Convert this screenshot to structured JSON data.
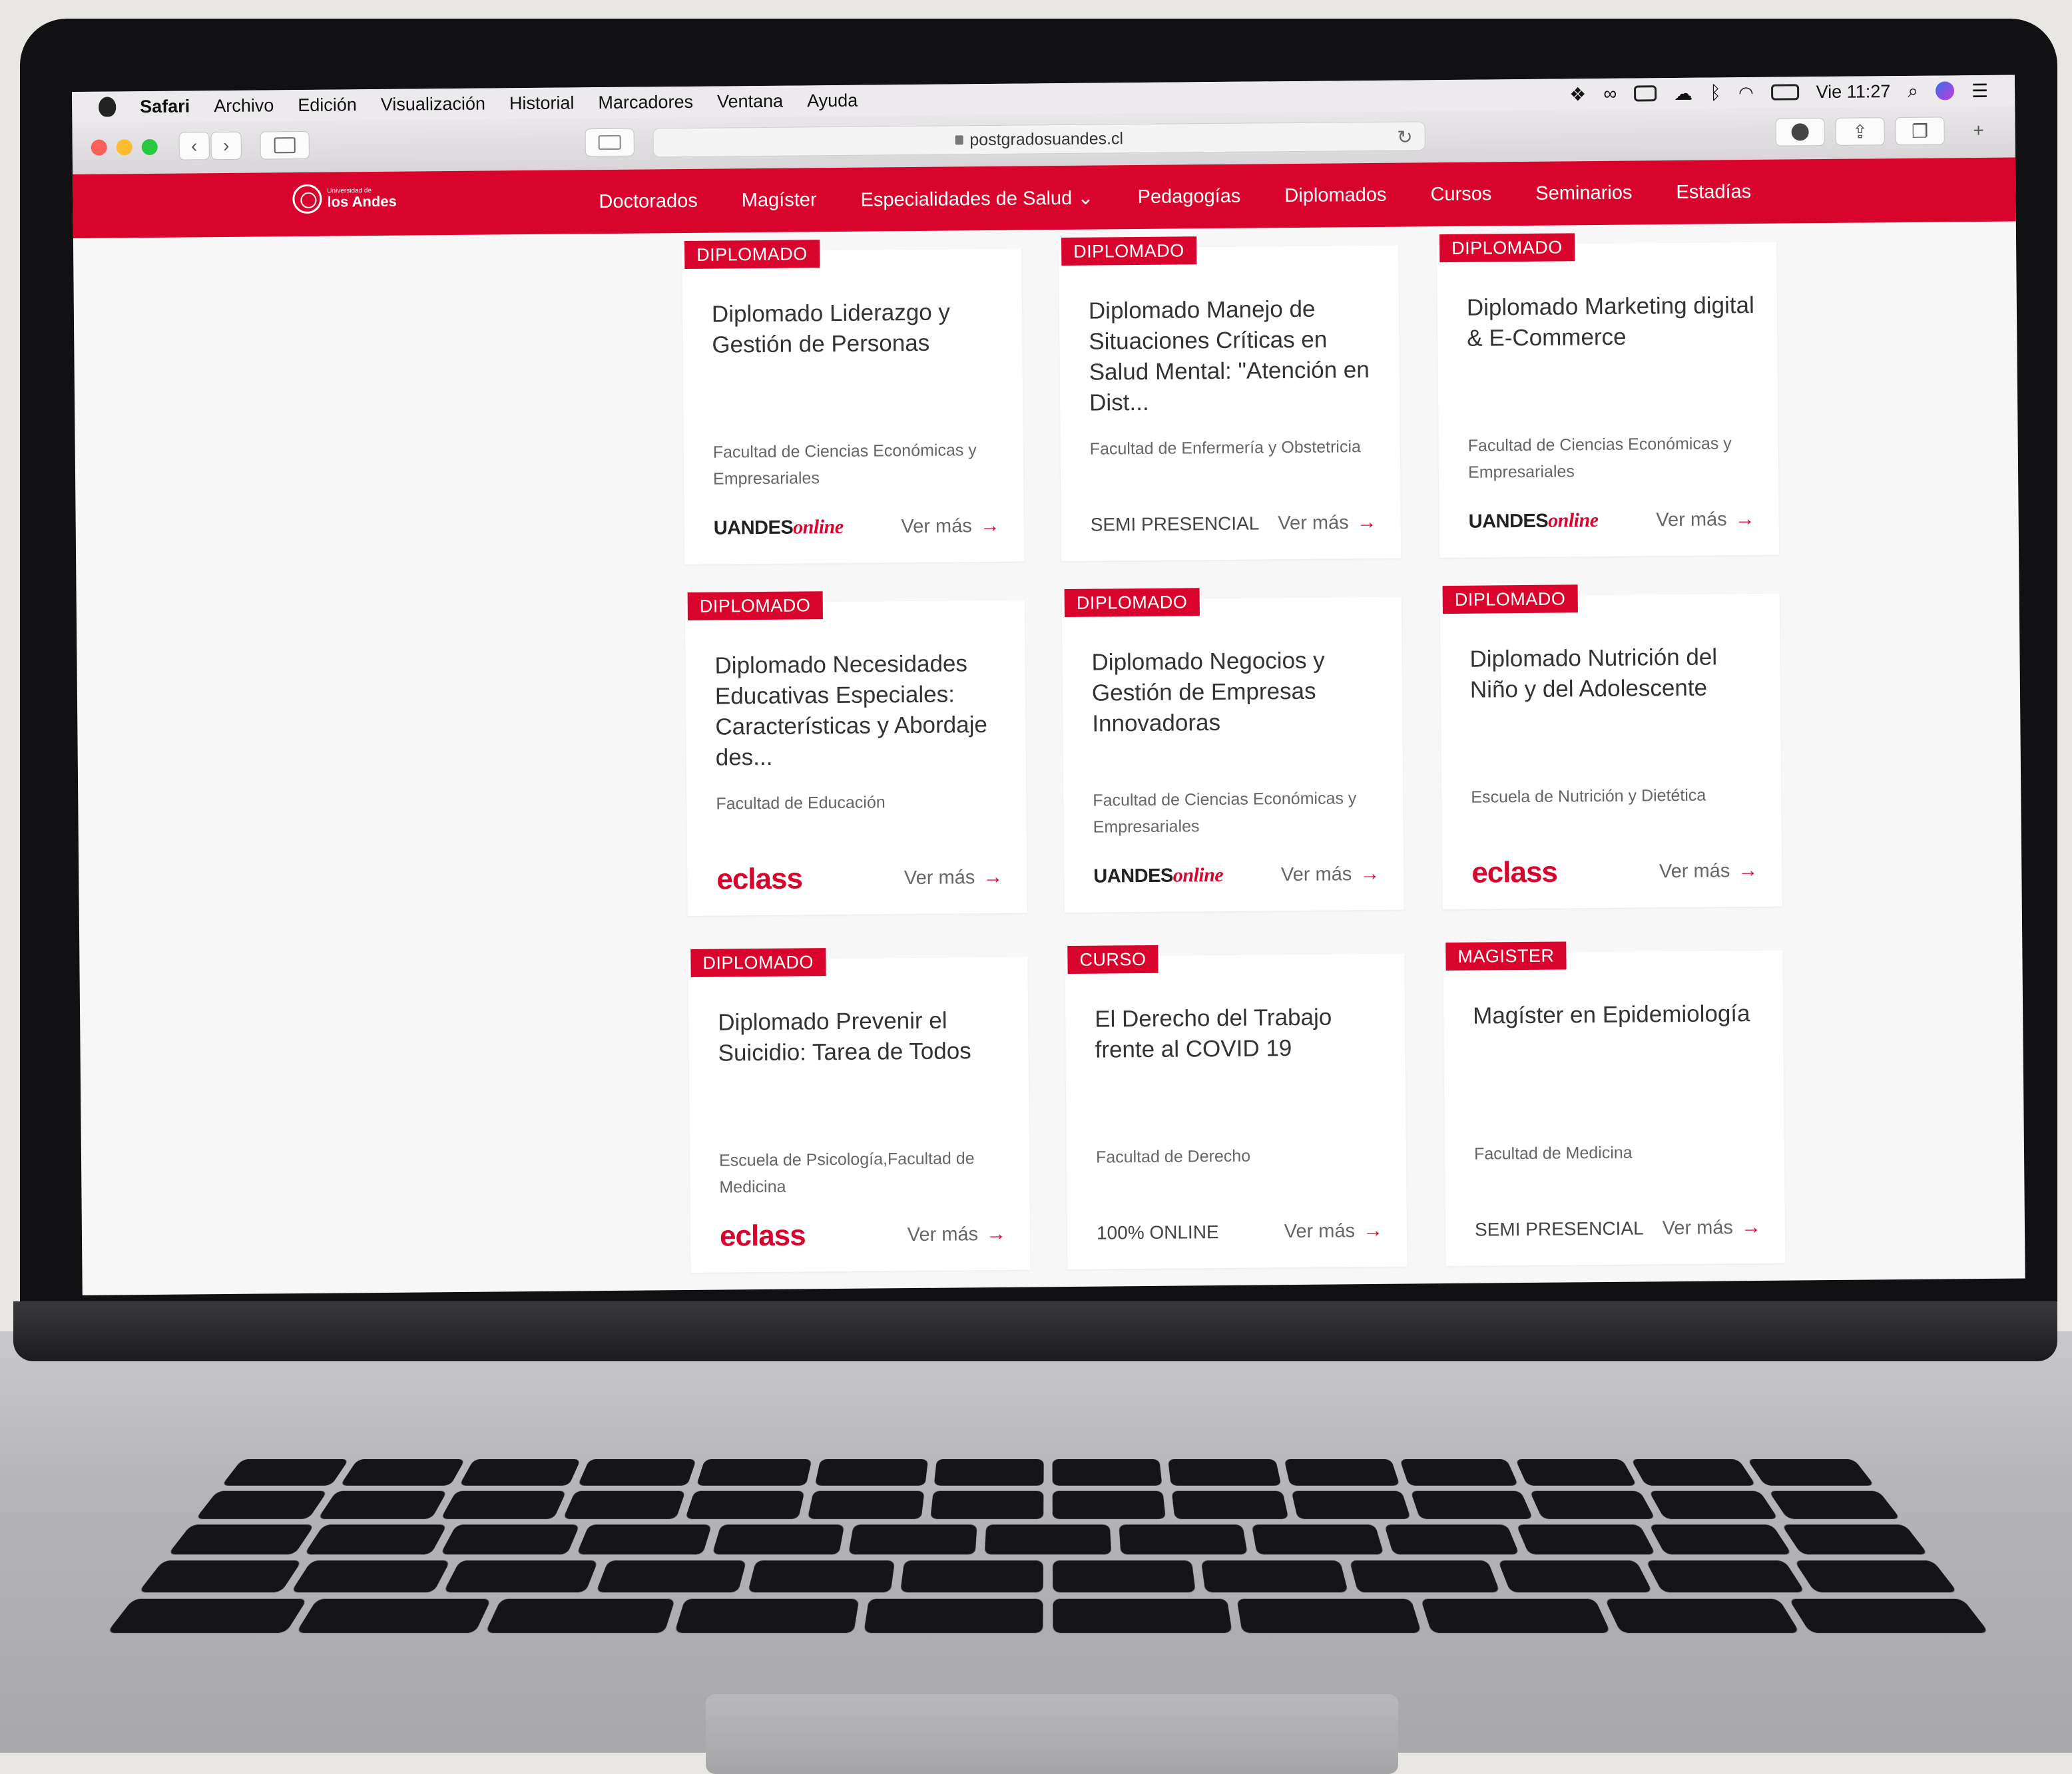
{
  "menubar": {
    "apple_icon": "apple-logo-icon",
    "app": "Safari",
    "items": [
      "Archivo",
      "Edición",
      "Visualización",
      "Historial",
      "Marcadores",
      "Ventana",
      "Ayuda"
    ],
    "clock": "Vie 11:27"
  },
  "browser": {
    "url": "postgradosuandes.cl"
  },
  "site": {
    "logo_small": "Universidad de",
    "logo_big": "los Andes",
    "nav": [
      "Doctorados",
      "Magíster",
      "Especialidades de Salud ⌄",
      "Pedagogías",
      "Diplomados",
      "Cursos",
      "Seminarios",
      "Estadías"
    ]
  },
  "cards": [
    {
      "badge": "DIPLOMADO",
      "title": "Diplomado Liderazgo y Gestión de Personas",
      "faculty": "Facultad de Ciencias Económicas y Empresariales",
      "label": "UANDES",
      "label_suffix": "online",
      "label_type": "uandes",
      "more": "Ver más"
    },
    {
      "badge": "DIPLOMADO",
      "title": "Diplomado Manejo de Situaciones Críticas en Salud Mental: \"Atención en Dist...",
      "faculty": "Facultad de Enfermería y Obstetricia",
      "label": "SEMI PRESENCIAL",
      "label_suffix": "",
      "label_type": "text",
      "more": "Ver más"
    },
    {
      "badge": "DIPLOMADO",
      "title": "Diplomado Marketing digital & E-Commerce",
      "faculty": "Facultad de Ciencias Económicas y Empresariales",
      "label": "UANDES",
      "label_suffix": "online",
      "label_type": "uandes",
      "more": "Ver más"
    },
    {
      "badge": "DIPLOMADO",
      "title": "Diplomado Necesidades Educativas Especiales: Características y Abordaje des...",
      "faculty": "Facultad de Educación",
      "label": "eclass",
      "label_suffix": "",
      "label_type": "eclass",
      "more": "Ver más"
    },
    {
      "badge": "DIPLOMADO",
      "title": "Diplomado Negocios y Gestión de Empresas Innovadoras",
      "faculty": "Facultad de Ciencias Económicas y Empresariales",
      "label": "UANDES",
      "label_suffix": "online",
      "label_type": "uandes",
      "more": "Ver más"
    },
    {
      "badge": "DIPLOMADO",
      "title": "Diplomado Nutrición del Niño y del Adolescente",
      "faculty": "Escuela de Nutrición y Dietética",
      "label": "eclass",
      "label_suffix": "",
      "label_type": "eclass",
      "more": "Ver más"
    },
    {
      "badge": "DIPLOMADO",
      "title": "Diplomado Prevenir el Suicidio: Tarea de Todos",
      "faculty": "Escuela de Psicología,Facultad de Medicina",
      "label": "eclass",
      "label_suffix": "",
      "label_type": "eclass",
      "more": "Ver más"
    },
    {
      "badge": "CURSO",
      "title": "El Derecho del Trabajo frente al COVID 19",
      "faculty": "Facultad de Derecho",
      "label": "100% ONLINE",
      "label_suffix": "",
      "label_type": "text",
      "more": "Ver más"
    },
    {
      "badge": "MAGISTER",
      "title": "Magíster en Epidemiología",
      "faculty": "Facultad de Medicina",
      "label": "SEMI PRESENCIAL",
      "label_suffix": "",
      "label_type": "text",
      "more": "Ver más"
    }
  ],
  "colors": {
    "brand_red": "#d9042b"
  }
}
